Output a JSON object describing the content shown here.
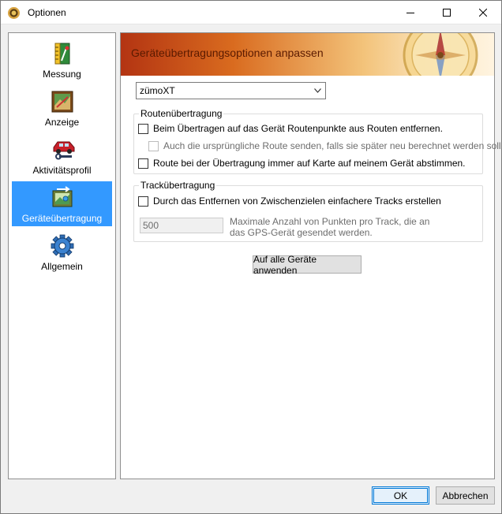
{
  "window": {
    "title": "Optionen",
    "icon": "app-globe-icon"
  },
  "sidebar": {
    "items": [
      {
        "label": "Messung",
        "icon": "measure-ruler-icon",
        "active": false
      },
      {
        "label": "Anzeige",
        "icon": "map-display-icon",
        "active": false
      },
      {
        "label": "Aktivitätsprofil",
        "icon": "car-profile-icon",
        "active": false
      },
      {
        "label": "Geräteübertragung",
        "icon": "device-transfer-icon",
        "active": true
      },
      {
        "label": "Allgemein",
        "icon": "gear-icon",
        "active": false
      }
    ]
  },
  "main": {
    "banner_title": "Geräteübertragungsoptionen anpassen",
    "device_select": {
      "value": "zümoXT"
    },
    "route_group": {
      "legend": "Routenübertragung",
      "options": [
        {
          "label": "Beim Übertragen auf das Gerät Routenpunkte aus Routen entfernen.",
          "checked": false,
          "enabled": true
        },
        {
          "label": "Auch die ursprüngliche Route senden, falls sie später neu berechnet werden soll.",
          "checked": false,
          "enabled": false
        },
        {
          "label": "Route bei der Übertragung immer auf Karte auf meinem Gerät abstimmen.",
          "checked": false,
          "enabled": true
        }
      ]
    },
    "track_group": {
      "legend": "Trackübertragung",
      "option": {
        "label": "Durch das Entfernen von Zwischenzielen einfachere Tracks erstellen",
        "checked": false,
        "enabled": true
      },
      "max_points_value": "500",
      "max_points_hint_line1": "Maximale Anzahl von Punkten pro Track, die an",
      "max_points_hint_line2": "das GPS-Gerät gesendet werden."
    },
    "apply_all_label": "Auf alle Geräte anwenden"
  },
  "footer": {
    "ok_label": "OK",
    "cancel_label": "Abbrechen"
  },
  "colors": {
    "selection": "#3399ff",
    "banner_start": "#b33412",
    "banner_end": "#fff4e0",
    "focus_border": "#0078d7"
  }
}
